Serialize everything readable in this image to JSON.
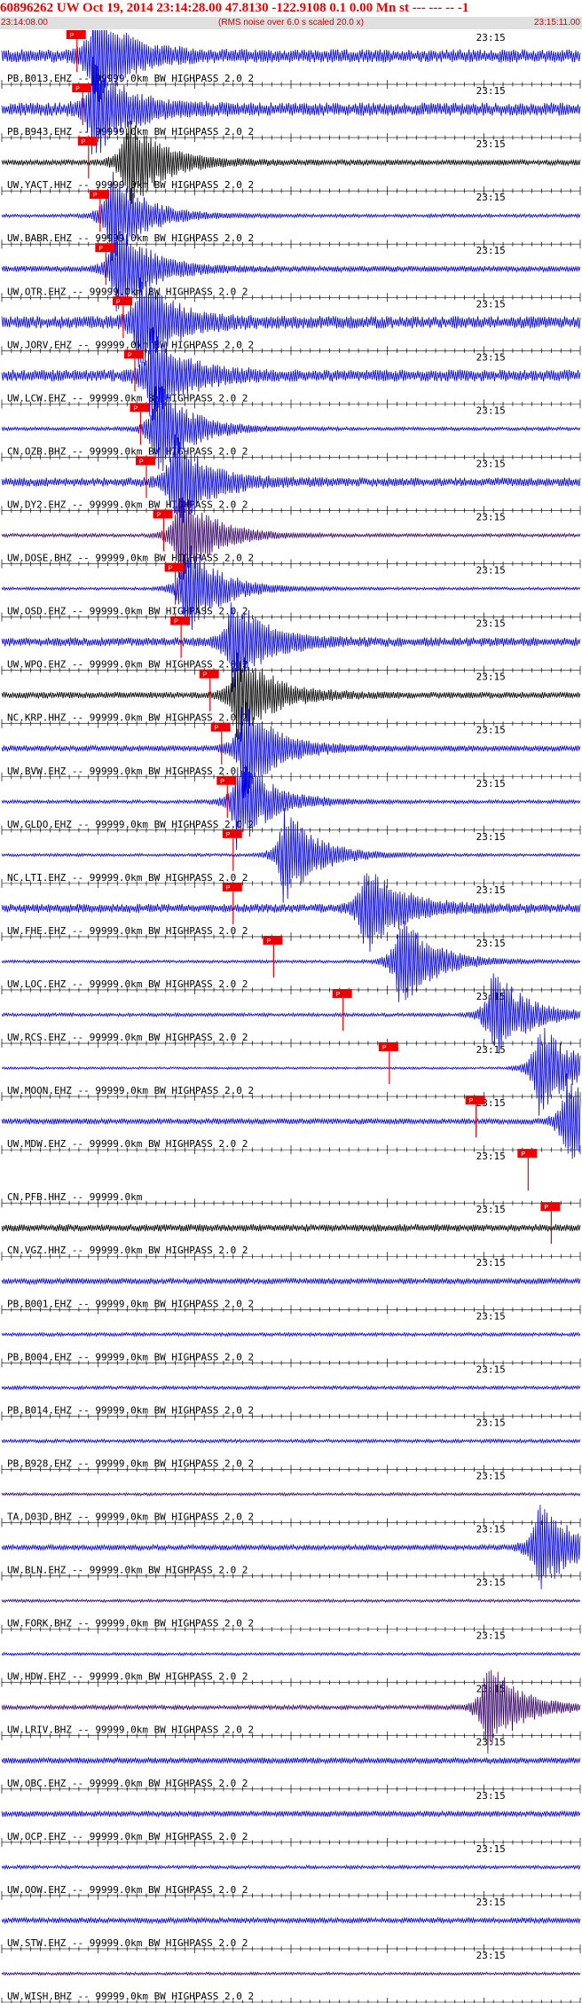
{
  "header": {
    "title": "60896262 UW Oct 19, 2014 23:14:28.00   47.8130 -122.9108  0.1 0.00 Mn st --- --- --  -1",
    "start_time": "23:14:08.00",
    "rms_note": "(RMS noise over 6.0 s scaled 20.0 x)",
    "end_time": "23:15:11.00"
  },
  "timing": {
    "tick_label": "23:15",
    "minute_fraction": 0.82
  },
  "colors": {
    "title": "#ee0000",
    "trace_blue": "#0000dd",
    "trace_black": "#000000",
    "trace_purple": "#330066",
    "pick_box": "#ee0000",
    "pick_line": "#ee0000"
  },
  "picks": {
    "label": "P",
    "positions": [
      0.13,
      0.14,
      0.15,
      0.17,
      0.18,
      0.185,
      0.21,
      0.23,
      0.24,
      0.25,
      0.28,
      0.3,
      0.31,
      0.36,
      0.38,
      0.39,
      0.4,
      0.4,
      0.47,
      0.59,
      0.67,
      0.82,
      0.91,
      0.95
    ]
  },
  "traces": [
    {
      "label": "PB.B013.EHZ -- 99999.0km BW  HIGHPASS  2.0  2",
      "color": "blue",
      "amp": 0.45,
      "burst": 0.16,
      "pick": 0.13
    },
    {
      "label": "PB.B943.EHZ -- 99999.0km BW  HIGHPASS  2.0  2",
      "color": "blue",
      "amp": 0.45,
      "burst": 0.16,
      "pick": 0.14
    },
    {
      "label": "UW.YACT.HHZ -- 99999.0km BW  HIGHPASS  2.0  2",
      "color": "black",
      "amp": 0.2,
      "burst": 0.22,
      "pick": 0.15
    },
    {
      "label": "UW.BABR.EHZ -- 99999.0km BW  HIGHPASS  2.0  2",
      "color": "blue",
      "amp": 0.12,
      "burst": 0.19,
      "pick": 0.17
    },
    {
      "label": "UW.OTR.EHZ -- 99999.0km BW  HIGHPASS  2.0  2",
      "color": "blue",
      "amp": 0.2,
      "burst": 0.2,
      "pick": 0.18
    },
    {
      "label": "UW.JORV.EHZ -- 99999.0km BW  HIGHPASS  2.0  2",
      "color": "blue",
      "amp": 0.42,
      "burst": 0.24,
      "pick": 0.21
    },
    {
      "label": "UW.LCW.EHZ -- 99999.0km BW  HIGHPASS  2.0  2",
      "color": "blue",
      "amp": 0.4,
      "burst": 0.26,
      "pick": 0.23
    },
    {
      "label": "CN.OZB.BHZ -- 99999.0km BW  HIGHPASS  2.0  2",
      "color": "blue",
      "amp": 0.12,
      "burst": 0.27,
      "pick": 0.24
    },
    {
      "label": "UW.DY2.EHZ -- 99999.0km BW  HIGHPASS  2.0  2",
      "color": "blue",
      "amp": 0.3,
      "burst": 0.3,
      "pick": 0.25
    },
    {
      "label": "UW.DOSE.BHZ -- 99999.0km BW  HIGHPASS  2.0  2",
      "color": "purple",
      "amp": 0.12,
      "burst": 0.31,
      "pick": 0.28
    },
    {
      "label": "UW.OSD.EHZ -- 99999.0km BW  HIGHPASS  2.0  2",
      "color": "blue",
      "amp": 0.1,
      "burst": 0.32,
      "pick": 0.3
    },
    {
      "label": "UW.WPO.EHZ -- 99999.0km BW  HIGHPASS  2.0  2",
      "color": "blue",
      "amp": 0.3,
      "burst": 0.4,
      "pick": 0.31
    },
    {
      "label": "NC.KRP.HHZ -- 99999.0km BW  HIGHPASS  2.0  2",
      "color": "black",
      "amp": 0.22,
      "burst": 0.41,
      "pick": 0.36
    },
    {
      "label": "UW.BVW.EHZ -- 99999.0km BW  HIGHPASS  2.0  2",
      "color": "blue",
      "amp": 0.2,
      "burst": 0.42,
      "pick": 0.38
    },
    {
      "label": "UW.GLDO.EHZ -- 99999.0km BW  HIGHPASS  2.0  2",
      "color": "blue",
      "amp": 0.12,
      "burst": 0.41,
      "pick": 0.39
    },
    {
      "label": "NC.LTI.EHZ -- 99999.0km BW  HIGHPASS  2.0  2",
      "color": "blue",
      "amp": 0.1,
      "burst": 0.49,
      "pick": 0.4
    },
    {
      "label": "UW.FHE.EHZ -- 99999.0km BW  HIGHPASS  2.0  2",
      "color": "blue",
      "amp": 0.3,
      "burst": 0.63,
      "pick": 0.4
    },
    {
      "label": "UW.LOC.EHZ -- 99999.0km BW  HIGHPASS  2.0  2",
      "color": "blue",
      "amp": 0.1,
      "burst": 0.69,
      "pick": 0.47
    },
    {
      "label": "UW.RCS.EHZ -- 99999.0km BW  HIGHPASS  2.0  2",
      "color": "blue",
      "amp": 0.12,
      "burst": 0.85,
      "pick": 0.59
    },
    {
      "label": "UW.MOON.EHZ -- 99999.0km BW  HIGHPASS  2.0  2",
      "color": "blue",
      "amp": 0.08,
      "burst": 0.93,
      "pick": 0.67
    },
    {
      "label": "UW.MDW.EHZ -- 99999.0km BW  HIGHPASS  2.0  2",
      "color": "blue",
      "amp": 0.2,
      "burst": 0.98,
      "pick": 0.82
    },
    {
      "label": "CN.PFB.HHZ -- 99999.0km",
      "color": "none",
      "amp": 0,
      "burst": null,
      "pick": 0.91
    },
    {
      "label": "CN.VGZ.HHZ -- 99999.0km BW  HIGHPASS  2.0  2",
      "color": "black",
      "amp": 0.25,
      "burst": null,
      "pick": 0.95
    },
    {
      "label": "PB.B001.EHZ -- 99999.0km BW  HIGHPASS  2.0  2",
      "color": "blue",
      "amp": 0.2,
      "burst": null
    },
    {
      "label": "PB.B004.EHZ -- 99999.0km BW  HIGHPASS  2.0  2",
      "color": "blue",
      "amp": 0.12,
      "burst": null
    },
    {
      "label": "PB.B014.EHZ -- 99999.0km BW  HIGHPASS  2.0  2",
      "color": "blue",
      "amp": 0.12,
      "burst": null
    },
    {
      "label": "PB.B928.EHZ -- 99999.0km BW  HIGHPASS  2.0  2",
      "color": "blue",
      "amp": 0.12,
      "burst": null
    },
    {
      "label": "TA.D03D.BHZ -- 99999.0km BW  HIGHPASS  2.0  2",
      "color": "purple",
      "amp": 0.1,
      "burst": null
    },
    {
      "label": "UW.BLN.EHZ -- 99999.0km BW  HIGHPASS  2.0  2",
      "color": "blue",
      "amp": 0.18,
      "burst": 0.93
    },
    {
      "label": "UW.FORK.BHZ -- 99999.0km BW  HIGHPASS  2.0  2",
      "color": "purple",
      "amp": 0.1,
      "burst": null
    },
    {
      "label": "UW.HDW.EHZ -- 99999.0km BW  HIGHPASS  2.0  2",
      "color": "blue",
      "amp": 0.1,
      "burst": null
    },
    {
      "label": "UW.LRIV.BHZ -- 99999.0km BW  HIGHPASS  2.0  2",
      "color": "purple",
      "amp": 0.15,
      "burst": 0.84
    },
    {
      "label": "UW.OBC.EHZ -- 99999.0km BW  HIGHPASS  2.0  2",
      "color": "blue",
      "amp": 0.2,
      "burst": null
    },
    {
      "label": "UW.OCP.EHZ -- 99999.0km BW  HIGHPASS  2.0  2",
      "color": "blue",
      "amp": 0.2,
      "burst": null
    },
    {
      "label": "UW.OOW.EHZ -- 99999.0km BW  HIGHPASS  2.0  2",
      "color": "blue",
      "amp": 0.12,
      "burst": null
    },
    {
      "label": "UW.STW.EHZ -- 99999.0km BW  HIGHPASS  2.0  2",
      "color": "blue",
      "amp": 0.18,
      "burst": null
    },
    {
      "label": "UW.WISH.BHZ -- 99999.0km BW  HIGHPASS  2.0  2",
      "color": "purple",
      "amp": 0.1,
      "burst": null
    }
  ]
}
